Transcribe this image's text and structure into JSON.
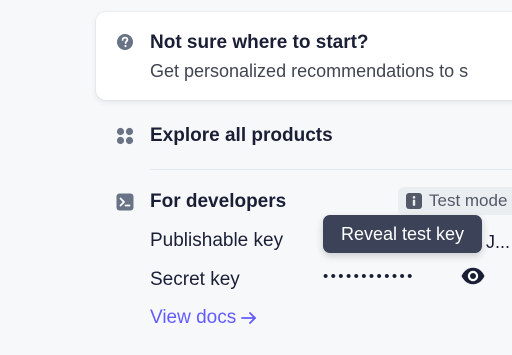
{
  "start_card": {
    "title": "Not sure where to start?",
    "subtitle": "Get personalized recommendations to s"
  },
  "explore": {
    "label": "Explore all products"
  },
  "developers": {
    "title": "For developers",
    "badge_label": "Test mode",
    "publishable_key_label": "Publishable key",
    "publishable_key_suffix": "J...",
    "secret_key_label": "Secret key",
    "secret_key_masked": "••••••••••••",
    "tooltip": "Reveal test key",
    "view_docs_label": "View docs"
  },
  "colors": {
    "link": "#635bff",
    "icon": "#697386",
    "tooltip_bg": "#3c4257"
  },
  "icons": [
    "question-circle-icon",
    "apps-grid-icon",
    "terminal-icon",
    "info-icon",
    "eye-icon",
    "arrow-right-icon"
  ]
}
